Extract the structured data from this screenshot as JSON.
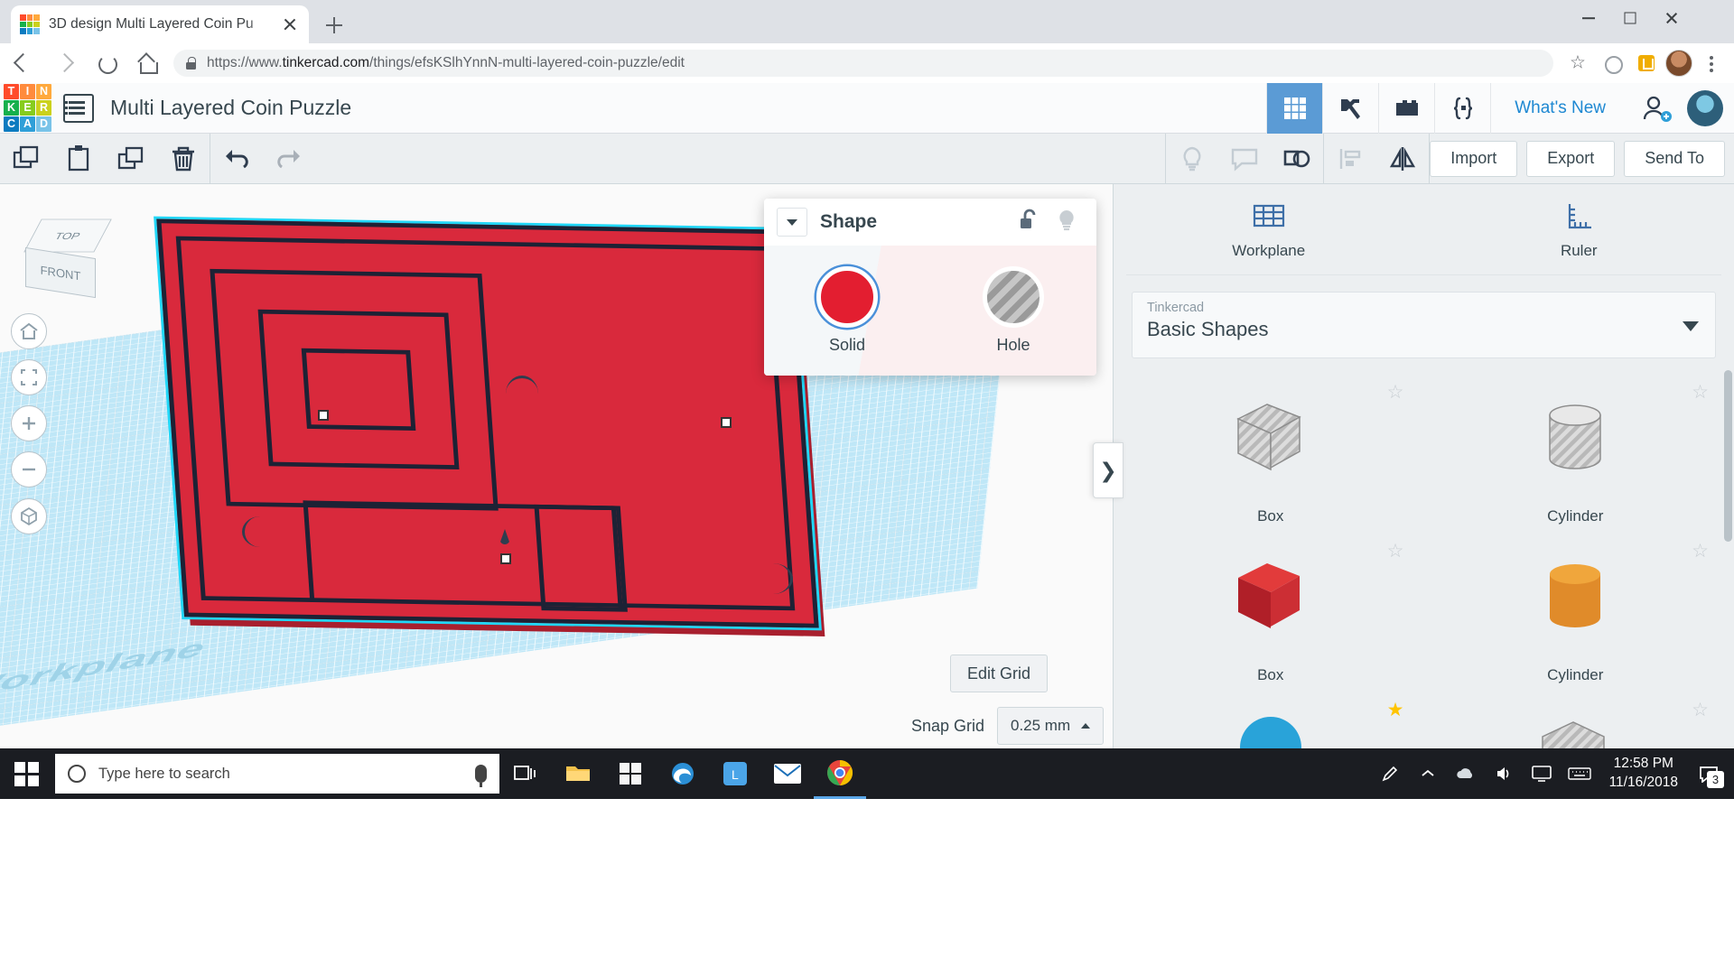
{
  "browser": {
    "tab_title": "3D design Multi Layered Coin Pu",
    "url_prefix": "https://www.",
    "url_domain": "tinkercad.com",
    "url_path": "/things/efsKSlhYnnN-multi-layered-coin-puzzle/edit",
    "url_full": "https://www.tinkercad.com/things/efsKSlhYnnN-multi-layered-coin-puzzle/edit",
    "icons": {
      "back": "back-arrow-icon",
      "forward": "forward-arrow-icon",
      "reload": "reload-icon",
      "home": "home-icon",
      "lock": "lock-icon",
      "star": "bookmark-star-icon",
      "menu": "chrome-menu-icon"
    },
    "window_controls": {
      "minimize": "minimize-icon",
      "maximize": "maximize-icon",
      "close": "close-icon"
    }
  },
  "tinkercad": {
    "logo_tiles": [
      {
        "letter": "T",
        "color": "#ff4b2b"
      },
      {
        "letter": "I",
        "color": "#ff8b3d"
      },
      {
        "letter": "N",
        "color": "#ffa93d"
      },
      {
        "letter": "K",
        "color": "#16b04c"
      },
      {
        "letter": "E",
        "color": "#86cc1e"
      },
      {
        "letter": "R",
        "color": "#cbd11c"
      },
      {
        "letter": "C",
        "color": "#0c7bc0"
      },
      {
        "letter": "A",
        "color": "#2e9fd8"
      },
      {
        "letter": "D",
        "color": "#79c3e8"
      }
    ],
    "project_title": "Multi Layered Coin Puzzle",
    "header_icons": [
      {
        "name": "grid-view-icon",
        "active": true
      },
      {
        "name": "minecraft-pickaxe-icon",
        "active": false
      },
      {
        "name": "lego-brick-icon",
        "active": false
      },
      {
        "name": "codeblocks-icon",
        "active": false
      }
    ],
    "whats_new": "What's New",
    "toolbar_left": [
      "copy-icon",
      "paste-icon",
      "duplicate-icon",
      "delete-icon",
      "undo-icon",
      "redo-icon"
    ],
    "toolbar_middle": [
      "lightbulb-icon",
      "note-icon",
      "group-icon",
      "align-icon",
      "mirror-icon"
    ],
    "toolbar_right_buttons": [
      "Import",
      "Export",
      "Send To"
    ]
  },
  "canvas": {
    "workplane_label": "Workplane",
    "viewcube": {
      "top_face": "TOP",
      "front_face": "FRONT"
    },
    "nav_buttons": [
      "home-view-icon",
      "fit-to-view-icon",
      "zoom-in-icon",
      "zoom-out-icon",
      "orthographic-icon"
    ],
    "edit_grid_label": "Edit Grid",
    "snap_grid_label": "Snap Grid",
    "snap_grid_value": "0.25 mm"
  },
  "shape_panel": {
    "title": "Shape",
    "collapse_icon": "chevron-down-icon",
    "lock_icon": "unlock-icon",
    "light_icon": "lightbulb-icon",
    "options": [
      {
        "label": "Solid",
        "color": "#e31e30",
        "selected": true
      },
      {
        "label": "Hole",
        "color": "#9a9a9a",
        "selected": false
      }
    ]
  },
  "sidebar": {
    "tools": [
      {
        "label": "Workplane",
        "icon": "workplane-icon"
      },
      {
        "label": "Ruler",
        "icon": "ruler-icon"
      }
    ],
    "library_sub": "Tinkercad",
    "library_name": "Basic Shapes",
    "library_caret": "chevron-down-icon",
    "shapes": [
      {
        "label": "Box",
        "icon": "box-hole-icon",
        "starred": false
      },
      {
        "label": "Cylinder",
        "icon": "cylinder-hole-icon",
        "starred": false
      },
      {
        "label": "Box",
        "icon": "box-solid-red-icon",
        "starred": false
      },
      {
        "label": "Cylinder",
        "icon": "cylinder-solid-orange-icon",
        "starred": false
      },
      {
        "label": "",
        "icon": "sphere-solid-blue-icon",
        "starred": true
      },
      {
        "label": "",
        "icon": "roof-shape-icon",
        "starred": false
      }
    ],
    "panel_toggle": "❯"
  },
  "taskbar": {
    "start_icon": "windows-start-icon",
    "search_placeholder": "Type here to search",
    "search_icon": "cortana-circle-icon",
    "mic_icon": "microphone-icon",
    "buttons": [
      {
        "name": "task-view-icon"
      },
      {
        "name": "file-explorer-icon"
      },
      {
        "name": "microsoft-store-icon"
      },
      {
        "name": "edge-icon"
      },
      {
        "name": "lightroom-icon"
      },
      {
        "name": "mail-icon"
      },
      {
        "name": "chrome-icon",
        "running": true
      }
    ],
    "tray": [
      "pen-icon",
      "show-hidden-icon",
      "onedrive-icon",
      "volume-icon",
      "display-icon",
      "keyboard-icon"
    ],
    "time": "12:58 PM",
    "date": "11/16/2018",
    "notification_count": "3"
  }
}
